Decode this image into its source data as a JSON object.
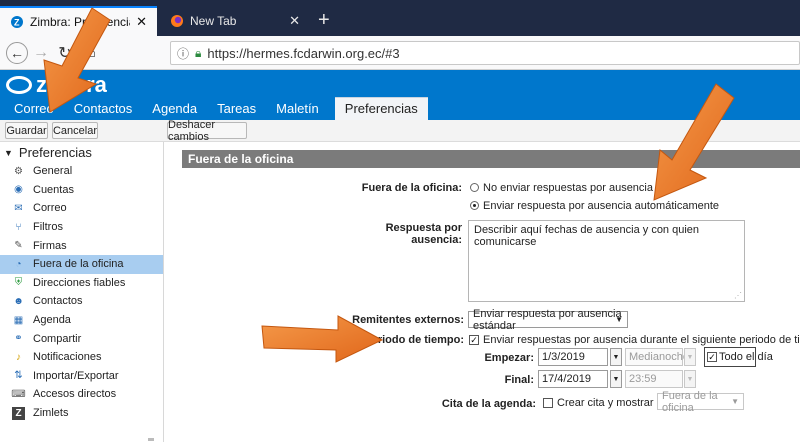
{
  "browser": {
    "tabs": [
      {
        "title": "Zimbra: Preferencias: Fuera de la of",
        "active": true
      },
      {
        "title": "New Tab",
        "active": false
      }
    ],
    "new_tab_symbol": "+",
    "tab_close_symbol": "✕",
    "url": "https://hermes.fcdarwin.org.ec/#3"
  },
  "zimbra": {
    "logo_text": "zimbra",
    "app_tabs": [
      {
        "label": "Correo"
      },
      {
        "label": "Contactos"
      },
      {
        "label": "Agenda"
      },
      {
        "label": "Tareas"
      },
      {
        "label": "Maletín"
      },
      {
        "label": "Preferencias",
        "active": true
      }
    ]
  },
  "toolbar": {
    "save_label": "Guardar",
    "cancel_label": "Cancelar",
    "undo_label": "Deshacer cambios"
  },
  "sidebar": {
    "title": "Preferencias",
    "items": [
      {
        "label": "General",
        "icon": "gear-icon"
      },
      {
        "label": "Cuentas",
        "icon": "accounts-icon"
      },
      {
        "label": "Correo",
        "icon": "mail-icon"
      },
      {
        "label": "Filtros",
        "icon": "filter-icon"
      },
      {
        "label": "Firmas",
        "icon": "signature-icon"
      },
      {
        "label": "Fuera de la oficina",
        "icon": "out-of-office-icon",
        "selected": true
      },
      {
        "label": "Direcciones fiables",
        "icon": "shield-icon"
      },
      {
        "label": "Contactos",
        "icon": "contacts-icon"
      },
      {
        "label": "Agenda",
        "icon": "calendar-icon"
      },
      {
        "label": "Compartir",
        "icon": "share-icon"
      },
      {
        "label": "Notificaciones",
        "icon": "bell-icon"
      },
      {
        "label": "Importar/Exportar",
        "icon": "import-export-icon"
      },
      {
        "label": "Accesos directos",
        "icon": "keyboard-icon"
      },
      {
        "label": "Zimlets",
        "icon": "zimlet-icon"
      }
    ]
  },
  "form": {
    "section_title": "Fuera de la oficina",
    "out_of_office_label": "Fuera de la oficina:",
    "radio_no_reply": "No enviar respuestas por ausencia",
    "radio_auto_reply": "Enviar respuesta por ausencia automáticamente",
    "selected_option": "auto_reply",
    "reply_label": "Respuesta por ausencia:",
    "reply_text": "Describir aquí fechas de ausencia y con quien comunicarse",
    "external_label": "Remitentes externos:",
    "external_value": "Enviar respuesta por ausencia estándar",
    "period_label": "Periodo de tiempo:",
    "period_checkbox": "Enviar respuestas por ausencia durante el siguiente periodo de tiempo:",
    "period_checked": true,
    "start_label": "Empezar:",
    "start_date": "1/3/2019",
    "start_time": "Medianoche",
    "all_day_label": "Todo el día",
    "all_day_checked": true,
    "end_label": "Final:",
    "end_date": "17/4/2019",
    "end_time": "23:59",
    "calendar_label": "Cita de la agenda:",
    "calendar_checkbox": "Crear cita y mostrar como:",
    "calendar_checked": false,
    "calendar_show_as": "Fuera de la oficina"
  },
  "colors": {
    "zimbra_blue": "#0077cc",
    "section_gray": "#7b7b7b",
    "selected_item": "#a8cdf0",
    "annotation_orange": "#f07a22"
  }
}
